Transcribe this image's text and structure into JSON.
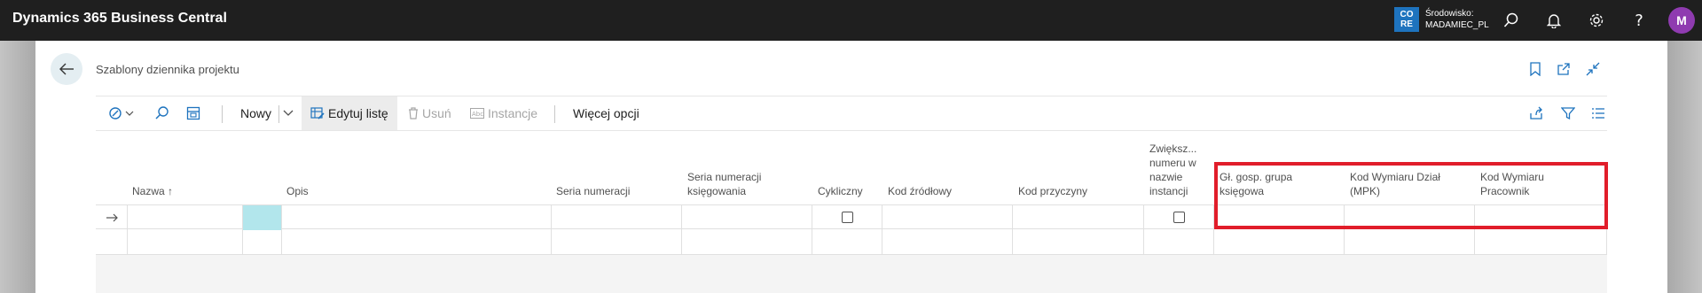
{
  "app": {
    "title": "Dynamics 365 Business Central",
    "env_badge_line1": "CO",
    "env_badge_line2": "RE",
    "env_label": "Środowisko:",
    "env_name": "MADAMIEC_PL",
    "avatar_initial": "M",
    "accent_color": "#1e73be",
    "avatar_color": "#8f3bb0"
  },
  "page": {
    "title": "Szablony dziennika projektu"
  },
  "actions": {
    "new_label": "Nowy",
    "edit_list_label": "Edytuj listę",
    "delete_label": "Usuń",
    "instances_label": "Instancje",
    "more_label": "Więcej opcji"
  },
  "columns": {
    "name": "Nazwa",
    "sort_indicator": "↑",
    "description": "Opis",
    "no_series": "Seria numeracji",
    "posting_no_series_1": "Seria numeracji",
    "posting_no_series_2": "księgowania",
    "recurring": "Cykliczny",
    "source_code": "Kod źródłowy",
    "reason_code": "Kod przyczyny",
    "incr_1": "Zwiększ...",
    "incr_2": "numeru w",
    "incr_3": "nazwie",
    "incr_4": "instancji",
    "gl_1": "Gł. gosp. grupa",
    "gl_2": "księgowa",
    "dim_dept_1": "Kod Wymiaru Dział",
    "dim_dept_2": "(MPK)",
    "dim_emp_1": "Kod Wymiaru",
    "dim_emp_2": "Pracownik"
  },
  "rows": [
    {
      "selected": true,
      "recurring": false,
      "incr": false
    },
    {
      "selected": false
    }
  ],
  "highlight_color": "#e11d2a"
}
